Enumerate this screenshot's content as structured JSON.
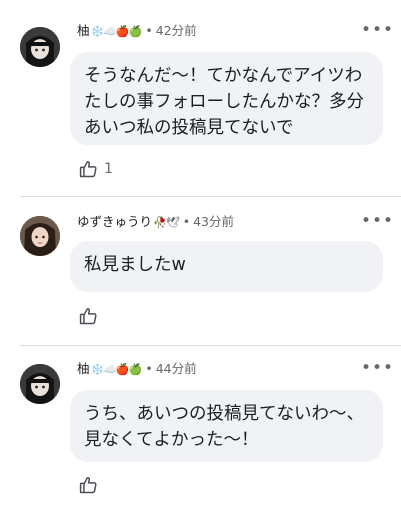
{
  "comments": [
    {
      "author": "柚",
      "emojis": "❄️☁️🍎🍏",
      "time": "42分前",
      "text": "そうなんだ〜！てかなんでアイツわたしの事フォローしたんかな？多分あいつ私の投稿見てないで",
      "likes": "1"
    },
    {
      "author": "ゆずきゅうり",
      "emojis": "🥀🕊",
      "time": "43分前",
      "text": "私見ましたw",
      "likes": ""
    },
    {
      "author": "柚",
      "emojis": "❄️☁️🍎🍏",
      "time": "44分前",
      "text": "うち、あいつの投稿見てないわ〜、見なくてよかった〜！",
      "likes": ""
    }
  ],
  "ui": {
    "more_label": "•••",
    "separator": "•"
  },
  "colors": {
    "bubble": "#f0f2f5",
    "meta_text": "#65676b",
    "divider": "#dadde1"
  }
}
